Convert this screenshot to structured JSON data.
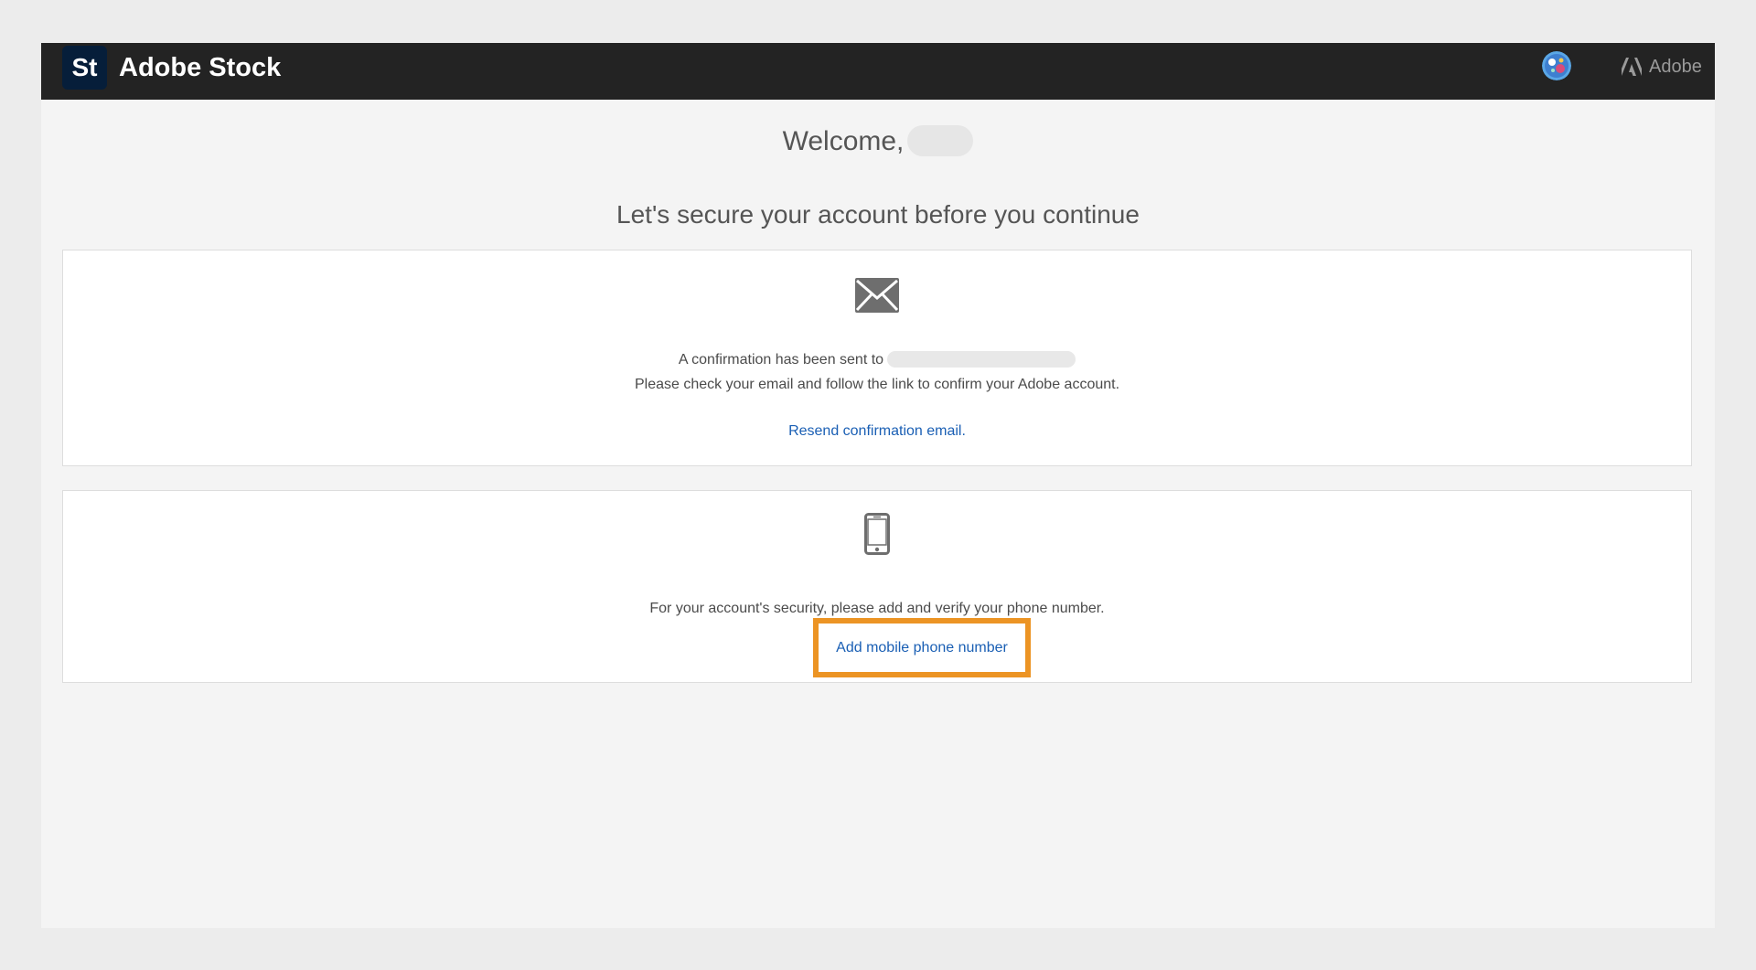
{
  "header": {
    "logo_text": "St",
    "app_name": "Adobe Stock",
    "adobe_label": "Adobe"
  },
  "welcome": {
    "greeting": "Welcome,"
  },
  "subtitle": "Let's secure your account before you continue",
  "email_card": {
    "icon": "envelope-icon",
    "sent_text": "A confirmation has been sent to",
    "instruction": "Please check your email and follow the link to confirm your Adobe account.",
    "resend_link": "Resend confirmation email."
  },
  "phone_card": {
    "icon": "smartphone-icon",
    "instruction": "For your account's security, please add and verify your phone number.",
    "add_link": "Add mobile phone number"
  },
  "colors": {
    "topbar": "#232323",
    "link": "#1a5fb4",
    "highlight": "#ec9424"
  }
}
